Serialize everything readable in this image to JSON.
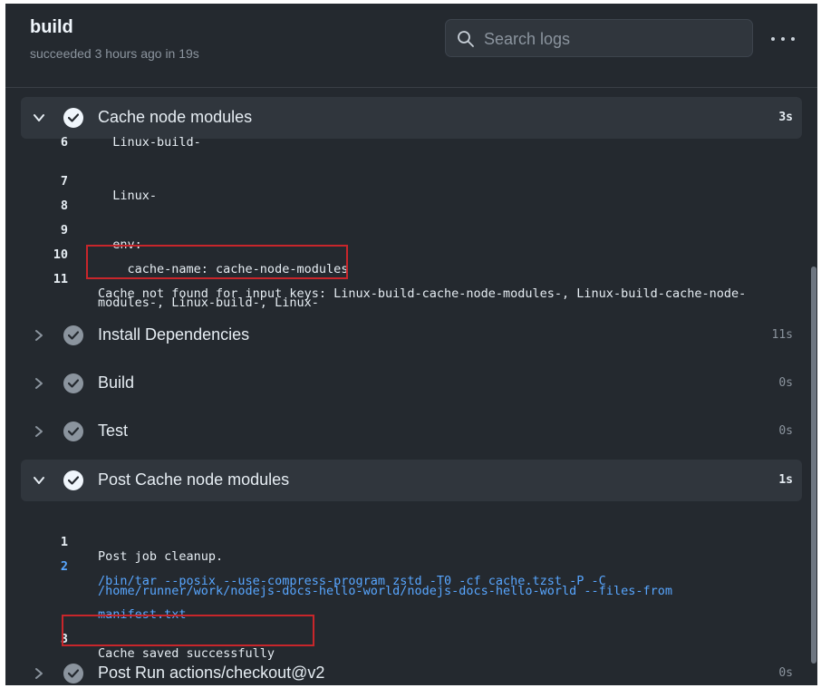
{
  "header": {
    "job_title": "build",
    "job_status": "succeeded 3 hours ago in 19s",
    "search_placeholder": "Search logs"
  },
  "colors": {
    "background": "#24292f",
    "highlight_box": "#c8262b",
    "link_blue": "#58a6ff"
  },
  "steps": [
    {
      "name": "Cache node modules",
      "duration": "3s",
      "expanded": true,
      "log_lines": [
        {
          "num": "6",
          "text": "  Linux-build-"
        },
        {
          "num": "7",
          "text": "  Linux-"
        },
        {
          "num": "8",
          "text": ""
        },
        {
          "num": "9",
          "text": "  env:"
        },
        {
          "num": "10",
          "text": "    cache-name: cache-node-modules"
        },
        {
          "num": "11",
          "text": "Cache not found for input keys: Linux-build-cache-node-modules-, Linux-build-cache-node-",
          "cont": "modules-, Linux-build-, Linux-"
        }
      ]
    },
    {
      "name": "Install Dependencies",
      "duration": "11s",
      "expanded": false
    },
    {
      "name": "Build",
      "duration": "0s",
      "expanded": false
    },
    {
      "name": "Test",
      "duration": "0s",
      "expanded": false
    },
    {
      "name": "Post Cache node modules",
      "duration": "1s",
      "expanded": true,
      "log_lines": [
        {
          "num": "1",
          "text": "Post job cleanup."
        },
        {
          "num": "2",
          "text": "/bin/tar --posix --use-compress-program zstd -T0 -cf cache.tzst -P -C",
          "cont": "/home/runner/work/nodejs-docs-hello-world/nodejs-docs-hello-world --files-from",
          "cont2": "manifest.txt"
        },
        {
          "num": "3",
          "text": "Cache saved successfully"
        }
      ]
    },
    {
      "name": "Post Run actions/checkout@v2",
      "duration": "0s",
      "expanded": false
    }
  ]
}
